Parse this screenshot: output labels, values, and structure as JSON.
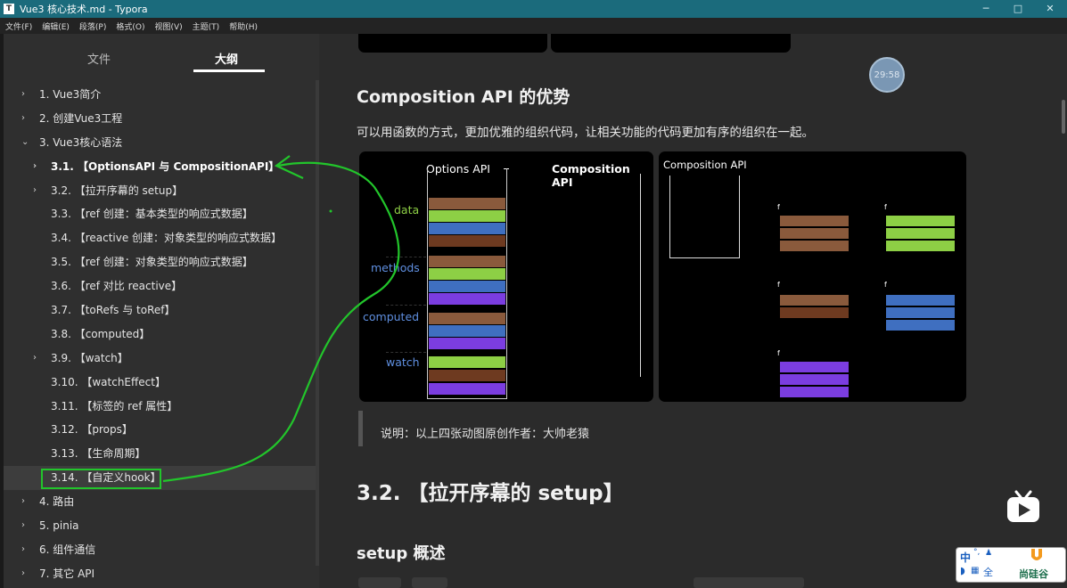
{
  "window": {
    "title": "Vue3 核心技术.md - Typora",
    "app_icon": "typora-icon",
    "min": "─",
    "max": "□",
    "close": "✕"
  },
  "menu": [
    "文件(F)",
    "编辑(E)",
    "段落(P)",
    "格式(O)",
    "视图(V)",
    "主题(T)",
    "帮助(H)"
  ],
  "sidebar": {
    "tabs": [
      "文件",
      "大纲"
    ],
    "outline": [
      {
        "label": "1. Vue3简介",
        "level": 0,
        "chevron": "›"
      },
      {
        "label": "2. 创建Vue3工程",
        "level": 0,
        "chevron": "›"
      },
      {
        "label": "3. Vue3核心语法",
        "level": 0,
        "chevron": "⌄"
      },
      {
        "label": "3.1. 【OptionsAPI 与 CompositionAPI】",
        "level": 1,
        "chevron": "›",
        "bold": true
      },
      {
        "label": "3.2. 【拉开序幕的 setup】",
        "level": 1,
        "chevron": "›"
      },
      {
        "label": "3.3. 【ref 创建：基本类型的响应式数据】",
        "level": 2
      },
      {
        "label": "3.4. 【reactive 创建：对象类型的响应式数据】",
        "level": 2
      },
      {
        "label": "3.5. 【ref 创建：对象类型的响应式数据】",
        "level": 2
      },
      {
        "label": "3.6. 【ref 对比 reactive】",
        "level": 2
      },
      {
        "label": "3.7. 【toRefs 与 toRef】",
        "level": 2
      },
      {
        "label": "3.8. 【computed】",
        "level": 2
      },
      {
        "label": "3.9. 【watch】",
        "level": 1,
        "chevron": "›"
      },
      {
        "label": "3.10. 【watchEffect】",
        "level": 2
      },
      {
        "label": "3.11. 【标签的 ref 属性】",
        "level": 2
      },
      {
        "label": "3.12. 【props】",
        "level": 2
      },
      {
        "label": "3.13. 【生命周期】",
        "level": 2
      },
      {
        "label": "3.14. 【自定义hook】",
        "level": 2,
        "highlight": true
      },
      {
        "label": "4. 路由",
        "level": 0,
        "chevron": "›"
      },
      {
        "label": "5. pinia",
        "level": 0,
        "chevron": "›"
      },
      {
        "label": "6. 组件通信",
        "level": 0,
        "chevron": "›"
      },
      {
        "label": "7. 其它 API",
        "level": 0,
        "chevron": "›"
      }
    ]
  },
  "editor": {
    "heading_comp": "Composition API 的优势",
    "paragraph": "可以用函数的方式，更加优雅的组织代码，让相关功能的代码更加有序的组织在一起。",
    "img1": {
      "options_title": "Options API",
      "composition_title": "Composition API",
      "data": "data",
      "methods": "methods",
      "computed": "computed",
      "watch": "watch"
    },
    "img2": {
      "title": "Composition API",
      "f": "f"
    },
    "quote": "说明：以上四张动图原创作者：大帅老猿",
    "h32": "3.2. 【拉开序幕的 setup】",
    "h_setup": "setup 概述"
  },
  "overlay": {
    "timer": "29:58",
    "ime": [
      "中",
      "°,",
      "全"
    ],
    "brand": "尚硅谷"
  },
  "colors": {
    "annotation": "#22c52b",
    "titlebar": "#1b6b7c",
    "brown": "#8a5a3c",
    "green": "#8dcf45",
    "blue": "#3f6fc0",
    "purple": "#7b3de0",
    "darkbrown": "#6e3a20"
  }
}
